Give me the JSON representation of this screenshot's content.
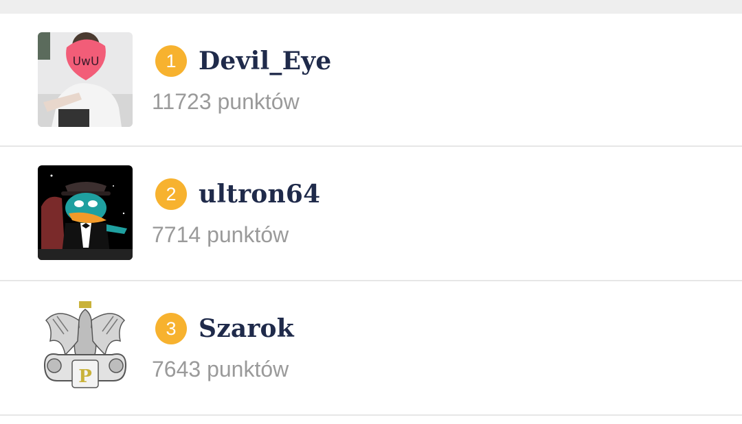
{
  "leaderboard": {
    "entries": [
      {
        "rank": "1",
        "username": "Devil_Eye",
        "points": "11723",
        "points_unit": "punktów",
        "avatar_text": "UwU"
      },
      {
        "rank": "2",
        "username": "ultron64",
        "points": "7714",
        "points_unit": "punktów"
      },
      {
        "rank": "3",
        "username": "Szarok",
        "points": "7643",
        "points_unit": "punktów",
        "avatar_text": "P"
      }
    ]
  },
  "colors": {
    "badge": "#f7b22f",
    "username": "#1f2a4a",
    "points": "#9a9a9a",
    "divider": "#e6e6e6",
    "topbar": "#eeeeee"
  }
}
